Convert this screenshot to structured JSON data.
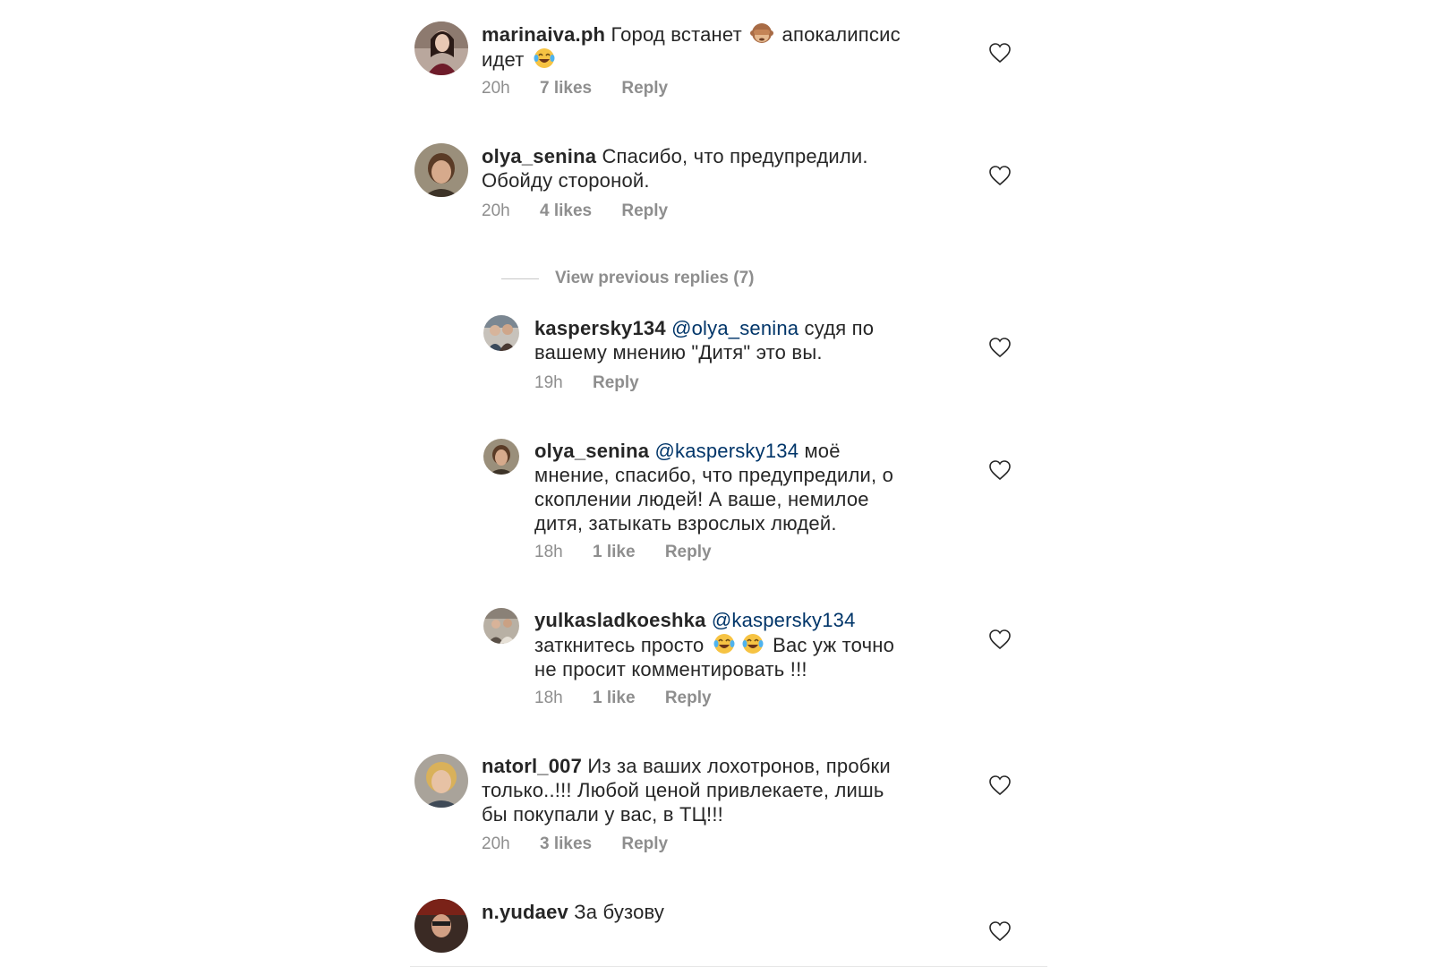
{
  "comments": [
    {
      "username": "marinaiva.ph",
      "lines": [
        "Город встанет",
        "апокалипсис",
        "идет"
      ],
      "emoji": [
        "see-no-evil-monkey-emoji",
        "tears-of-joy-emoji"
      ],
      "time": "20h",
      "likes": "7 likes",
      "reply": "Reply"
    },
    {
      "username": "olya_senina",
      "lines": [
        "Спасибо, что предупредили.",
        "Обойду стороной."
      ],
      "time": "20h",
      "likes": "4 likes",
      "reply": "Reply"
    },
    {
      "username": "kaspersky134",
      "mention": "@olya_senina",
      "lines": [
        "судя по",
        "вашему мнению \"Дитя\" это вы."
      ],
      "time": "19h",
      "reply": "Reply"
    },
    {
      "username": "olya_senina",
      "mention": "@kaspersky134",
      "lines": [
        "моё",
        "мнение, спасибо, что предупредили, о",
        "скоплении людей! А ваше, немилое",
        "дитя, затыкать взрослых людей."
      ],
      "time": "18h",
      "likes": "1 like",
      "reply": "Reply"
    },
    {
      "username": "yulkasladkoeshka",
      "mention": "@kaspersky134",
      "lines": [
        "заткнитесь просто",
        "Вас уж точно",
        "не просит комментировать !!!"
      ],
      "emoji": [
        "tears-of-joy-emoji",
        "tears-of-joy-emoji"
      ],
      "time": "18h",
      "likes": "1 like",
      "reply": "Reply"
    },
    {
      "username": "natorl_007",
      "lines": [
        "Из за ваших лохотронов, пробки",
        "только..!!! Любой ценой привлекаете, лишь",
        "бы покупали у вас, в ТЦ!!!"
      ],
      "time": "20h",
      "likes": "3 likes",
      "reply": "Reply"
    },
    {
      "username": "n.yudaev",
      "lines": [
        "За бузову"
      ]
    }
  ],
  "view_previous_replies": "View previous replies (7)",
  "colors": {
    "text": "#262626",
    "meta": "#8e8e8e",
    "mention": "#003569",
    "heart_stroke": "#262626"
  }
}
